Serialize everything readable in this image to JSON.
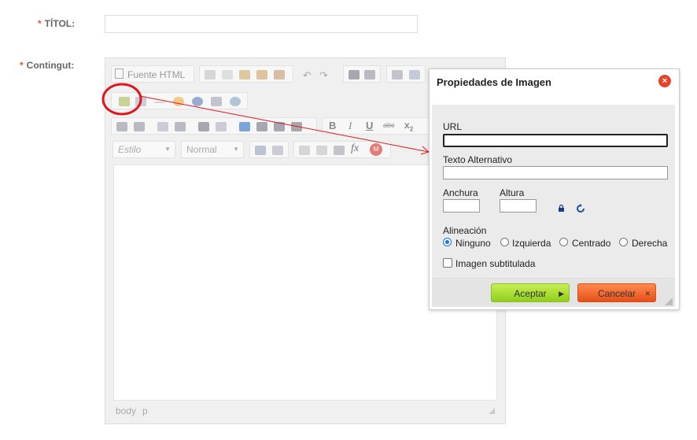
{
  "form": {
    "required_mark": "*",
    "title_label": "TÍTOL:",
    "content_label": "Contingut:"
  },
  "editor": {
    "source_button_label": "Fuente HTML",
    "style_combo": "Estilo",
    "format_combo": "Normal",
    "path": [
      "body",
      "p"
    ]
  },
  "dialog": {
    "title": "Propiedades de Imagen",
    "close_label": "×",
    "url_label": "URL",
    "url_value": "",
    "alt_label": "Texto Alternativo",
    "alt_value": "",
    "width_label": "Anchura",
    "height_label": "Altura",
    "align_label": "Alineación",
    "align_options": [
      "Ninguno",
      "Izquierda",
      "Centrado",
      "Derecha"
    ],
    "align_selected": "Ninguno",
    "caption_label": "Imagen subtitulada",
    "caption_checked": false,
    "ok_label": "Aceptar",
    "cancel_label": "Cancelar"
  },
  "colors": {
    "accent_red": "#e0161d",
    "ok_green": "#a6dc2c",
    "cancel_orange": "#f26a2a",
    "required_orange": "#e25a2b"
  },
  "icons": {
    "image": "image-icon",
    "lock": "lock-icon",
    "reset": "reset-size-icon",
    "close": "close-icon",
    "annotation": "red-circle-annotation"
  }
}
